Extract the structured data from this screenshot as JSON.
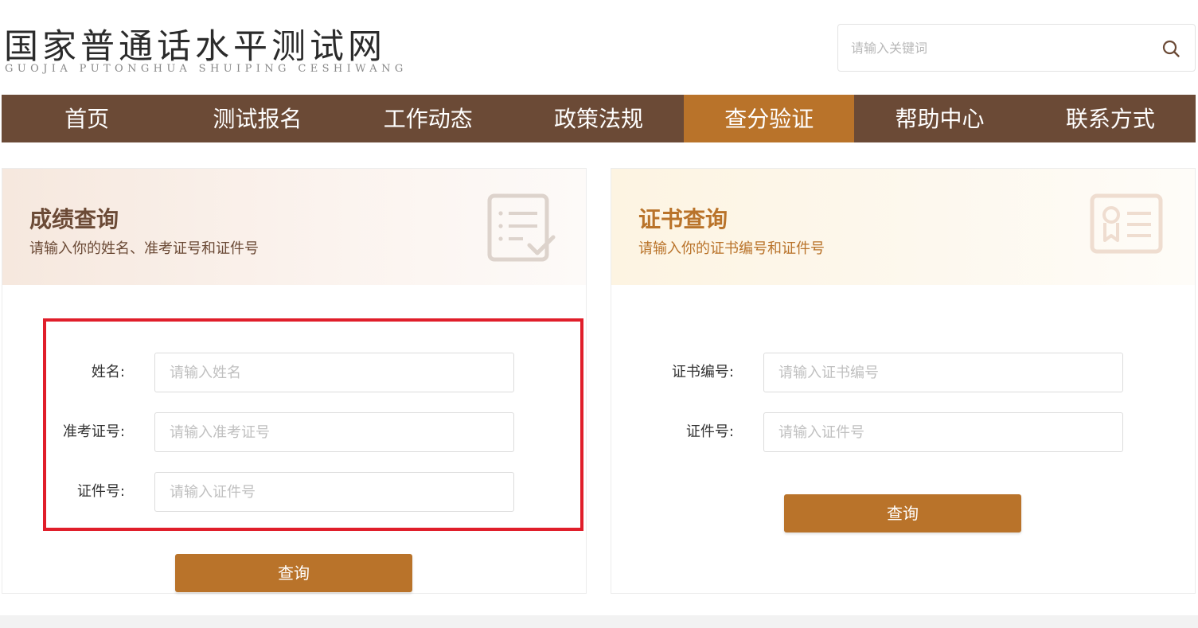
{
  "header": {
    "logo_title": "国家普通话水平测试网",
    "logo_subtitle": "GUOJIA PUTONGHUA SHUIPING CESHIWANG",
    "search_placeholder": "请输入关键词",
    "search_icon": "search-icon"
  },
  "nav": {
    "items": [
      {
        "label": "首页"
      },
      {
        "label": "测试报名"
      },
      {
        "label": "工作动态"
      },
      {
        "label": "政策法规"
      },
      {
        "label": "查分验证",
        "active": true
      },
      {
        "label": "帮助中心"
      },
      {
        "label": "联系方式"
      }
    ],
    "colors": {
      "bar": "#6b4a36",
      "active": "#b9732a"
    }
  },
  "score_query": {
    "title": "成绩查询",
    "description": "请输入你的姓名、准考证号和证件号",
    "icon": "checklist-icon",
    "fields": [
      {
        "label": "姓名:",
        "placeholder": "请输入姓名",
        "value": ""
      },
      {
        "label": "准考证号:",
        "placeholder": "请输入准考证号",
        "value": ""
      },
      {
        "label": "证件号:",
        "placeholder": "请输入证件号",
        "value": ""
      }
    ],
    "button_label": "查询",
    "highlight_color": "#e01e2a"
  },
  "certificate_query": {
    "title": "证书查询",
    "description": "请输入你的证书编号和证件号",
    "icon": "certificate-icon",
    "fields": [
      {
        "label": "证书编号:",
        "placeholder": "请输入证书编号",
        "value": ""
      },
      {
        "label": "证件号:",
        "placeholder": "请输入证件号",
        "value": ""
      }
    ],
    "button_label": "查询"
  }
}
